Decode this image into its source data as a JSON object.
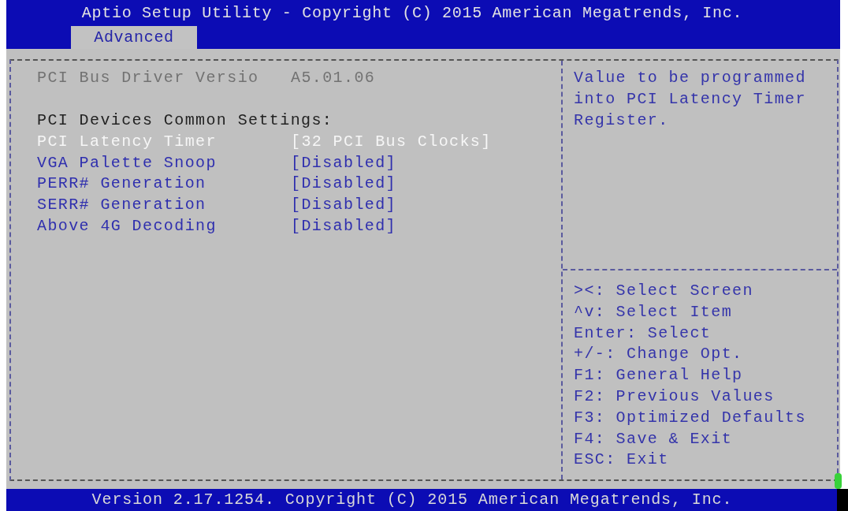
{
  "title": "Aptio Setup Utility - Copyright (C) 2015 American Megatrends, Inc.",
  "tabs": [
    {
      "label": "Advanced",
      "selected": true
    }
  ],
  "settings": [
    {
      "kind": "info",
      "label": "PCI Bus Driver Versio",
      "value": "A5.01.06"
    },
    {
      "kind": "heading",
      "label": "PCI Devices Common Settings:"
    },
    {
      "kind": "option",
      "label": "PCI Latency Timer",
      "value": "[32 PCI Bus Clocks]",
      "selected": true
    },
    {
      "kind": "option",
      "label": "VGA Palette Snoop",
      "value": "[Disabled]",
      "selected": false
    },
    {
      "kind": "option",
      "label": "PERR# Generation",
      "value": "[Disabled]",
      "selected": false
    },
    {
      "kind": "option",
      "label": "SERR# Generation",
      "value": "[Disabled]",
      "selected": false
    },
    {
      "kind": "option",
      "label": "Above 4G Decoding",
      "value": "[Disabled]",
      "selected": false
    }
  ],
  "help_text": "Value to be programmed into PCI Latency Timer Register.",
  "key_hints": [
    "><: Select Screen",
    "^v: Select Item",
    "Enter: Select",
    "+/-: Change Opt.",
    "F1: General Help",
    "F2: Previous Values",
    "F3: Optimized Defaults",
    "F4: Save & Exit",
    "ESC: Exit"
  ],
  "footer": "Version 2.17.1254. Copyright (C) 2015 American Megatrends, Inc."
}
